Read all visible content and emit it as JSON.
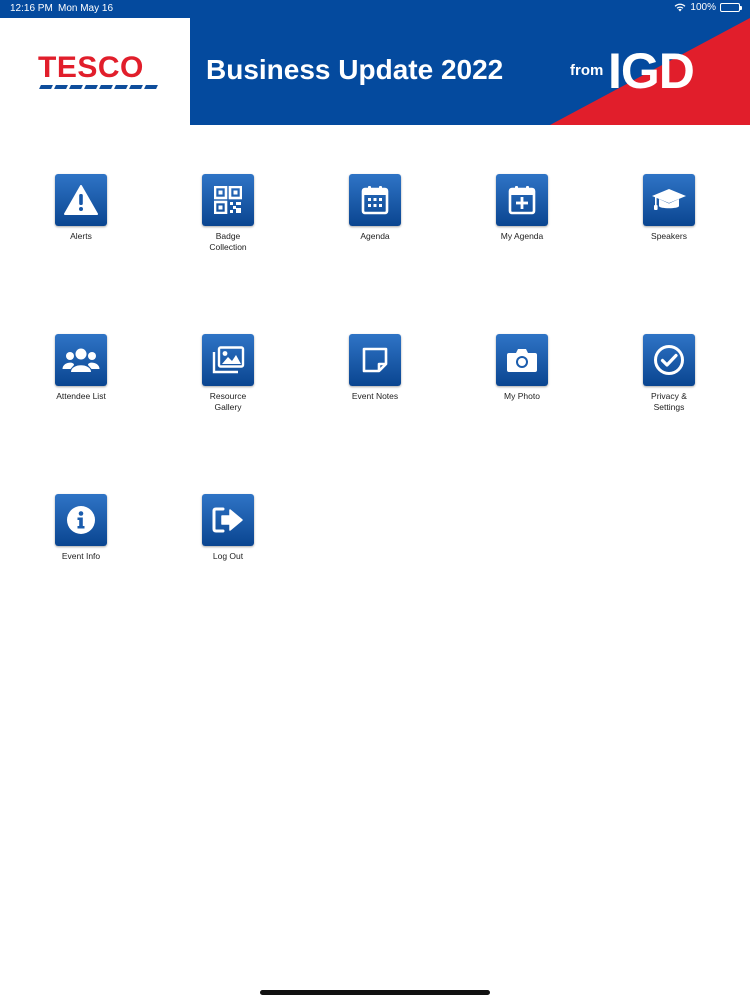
{
  "status": {
    "time": "12:16 PM",
    "date": "Mon May 16",
    "battery": "100%",
    "wifi_icon": "wifi-icon",
    "battery_icon": "battery-icon"
  },
  "banner": {
    "logo": "TESCO",
    "title": "Business Update 2022",
    "from": "from",
    "partner": "IGD",
    "colors": {
      "blue": "#044a9e",
      "red": "#e11e2b"
    }
  },
  "tiles": [
    {
      "label": "Alerts",
      "icon": "alert-triangle-icon"
    },
    {
      "label": "Badge\nCollection",
      "icon": "qr-code-icon"
    },
    {
      "label": "Agenda",
      "icon": "calendar-icon"
    },
    {
      "label": "My Agenda",
      "icon": "calendar-plus-icon"
    },
    {
      "label": "Speakers",
      "icon": "graduation-cap-icon"
    },
    {
      "label": "Attendee List",
      "icon": "users-icon"
    },
    {
      "label": "Resource\nGallery",
      "icon": "images-icon"
    },
    {
      "label": "Event Notes",
      "icon": "sticky-note-icon"
    },
    {
      "label": "My Photo",
      "icon": "camera-icon"
    },
    {
      "label": "Privacy &\nSettings",
      "icon": "check-circle-icon"
    },
    {
      "label": "Event Info",
      "icon": "info-icon"
    },
    {
      "label": "Log Out",
      "icon": "logout-icon"
    }
  ]
}
